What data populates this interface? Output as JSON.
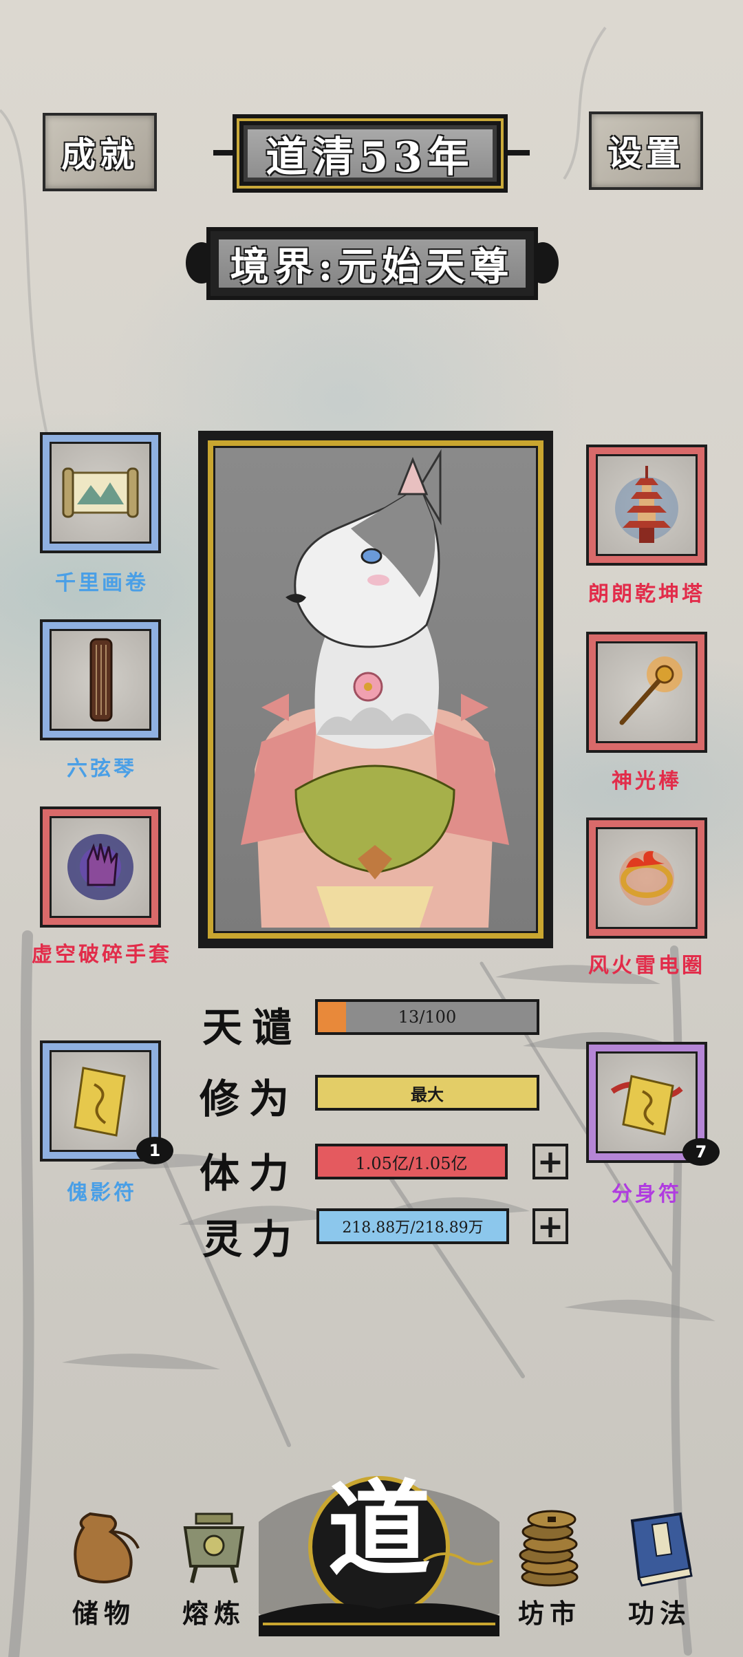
{
  "header": {
    "achievements_label": "成就",
    "year_label": "道清53年",
    "settings_label": "设置",
    "realm_label": "境界:元始天尊"
  },
  "left_items": [
    {
      "name": "千里画卷",
      "color": "blue"
    },
    {
      "name": "六弦琴",
      "color": "blue"
    },
    {
      "name": "虚空破碎手套",
      "color": "red"
    },
    {
      "name": "傀影符",
      "color": "blue",
      "count": "1"
    }
  ],
  "right_items": [
    {
      "name": "朗朗乾坤塔",
      "color": "red"
    },
    {
      "name": "神光棒",
      "color": "red"
    },
    {
      "name": "风火雷电圈",
      "color": "red"
    },
    {
      "name": "分身符",
      "color": "purple",
      "count": "7"
    }
  ],
  "stats": {
    "tianqian": {
      "label": "天谴",
      "value": "13/100",
      "fill": 0.13,
      "color": "#e8893a"
    },
    "xiuwei": {
      "label": "修为",
      "value": "最大",
      "fill": 1.0,
      "color": "#e3cd67"
    },
    "tili": {
      "label": "体力",
      "value": "1.05亿/1.05亿",
      "fill": 1.0,
      "color": "#e45a5f"
    },
    "lingli": {
      "label": "灵力",
      "value": "218.88万/218.89万",
      "fill": 1.0,
      "color": "#8cc7ec"
    }
  },
  "plus_label": "+",
  "nav": {
    "storage": "储物",
    "smelting": "熔炼",
    "dao": "道",
    "market": "坊市",
    "techniques": "功法"
  }
}
